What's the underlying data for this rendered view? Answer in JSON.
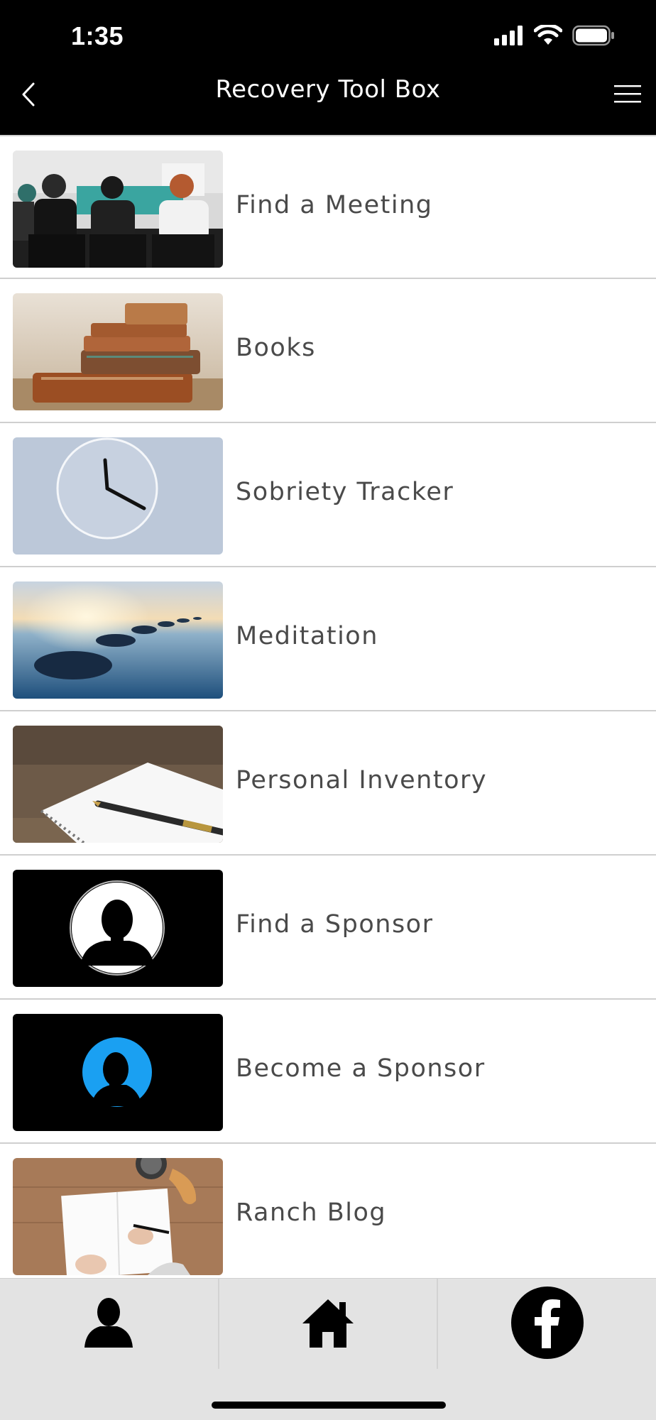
{
  "status_bar": {
    "time": "1:35"
  },
  "header": {
    "title": "Recovery Tool Box",
    "back_icon": "chevron-left-icon",
    "menu_icon": "hamburger-menu-icon"
  },
  "items": [
    {
      "label": "Find a Meeting",
      "image": "meeting-photo"
    },
    {
      "label": "Books",
      "image": "books-photo"
    },
    {
      "label": "Sobriety Tracker",
      "image": "clock-photo"
    },
    {
      "label": "Meditation",
      "image": "stones-water-photo"
    },
    {
      "label": "Personal Inventory",
      "image": "notebook-pen-photo"
    },
    {
      "label": "Find a Sponsor",
      "image": "silhouette-white-circle-photo"
    },
    {
      "label": "Become a Sponsor",
      "image": "silhouette-blue-circle-photo"
    },
    {
      "label": "Ranch Blog",
      "image": "journal-writing-photo"
    }
  ],
  "tab_bar": {
    "tabs": [
      {
        "icon": "person-icon"
      },
      {
        "icon": "home-icon"
      },
      {
        "icon": "facebook-icon"
      }
    ]
  },
  "colors": {
    "header_bg": "#000000",
    "tab_bar_bg": "#e3e3e3",
    "label_text": "#4a4a4a",
    "divider": "#cfcfcf"
  }
}
